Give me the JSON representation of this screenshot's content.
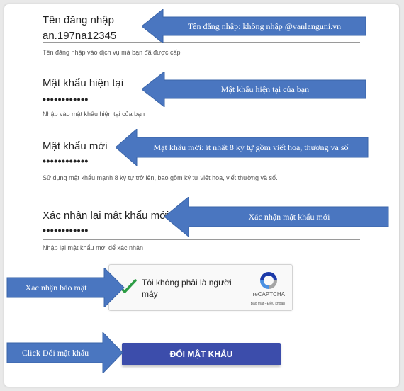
{
  "form": {
    "username": {
      "label": "Tên đăng nhập",
      "value": "an.197na12345",
      "hint": "Tên đăng nhập vào dịch vụ mà bạn đã được cấp"
    },
    "current_password": {
      "label": "Mật khẩu hiện tại",
      "value": "••••••••••••",
      "hint": "Nhập vào mật khẩu hiện tại của bạn"
    },
    "new_password": {
      "label": "Mật khẩu mới",
      "value": "••••••••••••",
      "hint": "Sử dụng mật khẩu mạnh 8 ký tự trở lên, bao gồm ký tự viết hoa, viết thường và số."
    },
    "confirm_password": {
      "label": "Xác nhận lại mật khẩu mới",
      "value": "••••••••••••",
      "hint": "Nhập lại mật khẩu mới để xác nhận"
    },
    "captcha": {
      "text": "Tôi không phải là người máy",
      "brand": "reCAPTCHA",
      "links": "Bảo mật - Điều khoản"
    },
    "submit_label": "ĐỔI MẬT KHẨU"
  },
  "annotations": {
    "username": "Tên đăng nhập: không nhập @vanlanguni.vn",
    "current_password": "Mật khẩu hiện tại của bạn",
    "new_password": "Mật khẩu mới: ít nhất 8 ký tự gồm viết hoa, thường và số",
    "confirm_password": "Xác nhận mật khẩu mới",
    "captcha": "Xác nhận bảo mật",
    "submit": "Click Đổi mật khẩu"
  },
  "colors": {
    "arrow": "#4a76c0",
    "arrow_border": "#3a64a8",
    "button": "#3c4dab",
    "check": "#2e9d45"
  }
}
